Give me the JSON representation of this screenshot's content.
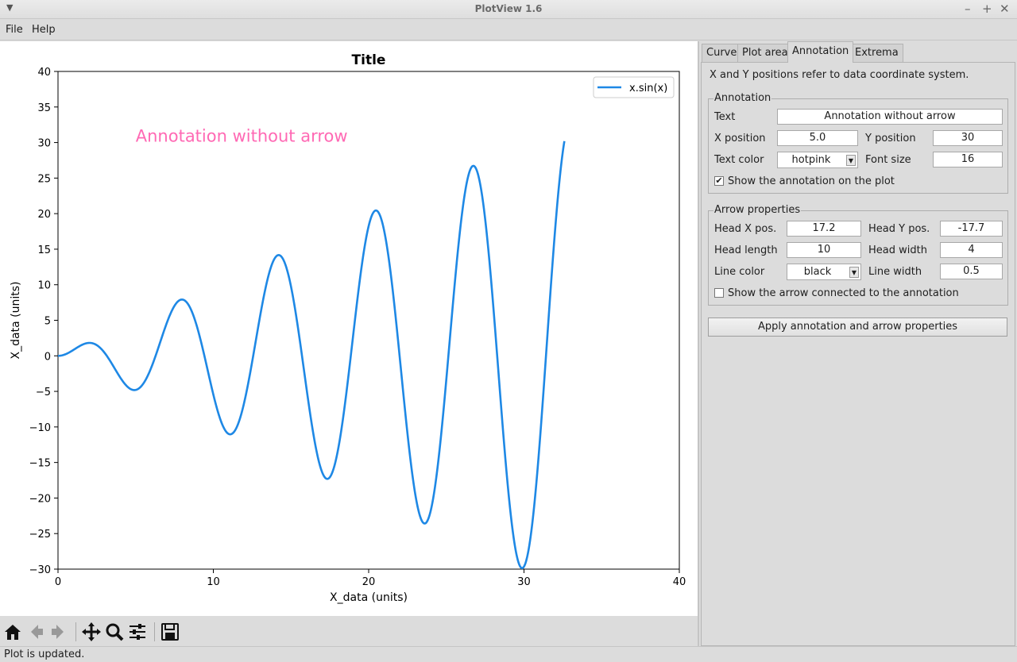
{
  "window": {
    "title": "PlotView 1.6"
  },
  "menu": {
    "file": "File",
    "help": "Help"
  },
  "tabs": [
    "Curve",
    "Plot area",
    "Annotation",
    "Extrema"
  ],
  "active_tab": "Annotation",
  "annotation_panel": {
    "info": "X and Y positions refer to data coordinate system.",
    "group_title": "Annotation",
    "text_label": "Text",
    "text_value": "Annotation without arrow",
    "xpos_label": "X position",
    "xpos_value": "5.0",
    "ypos_label": "Y position",
    "ypos_value": "30",
    "color_label": "Text color",
    "color_value": "hotpink",
    "fontsize_label": "Font size",
    "fontsize_value": "16",
    "show_label": "Show the annotation on the plot",
    "show_checked": true
  },
  "arrow_panel": {
    "group_title": "Arrow properties",
    "headx_label": "Head X pos.",
    "headx_value": "17.2",
    "heady_label": "Head Y pos.",
    "heady_value": "-17.7",
    "headlen_label": "Head length",
    "headlen_value": "10",
    "headwidth_label": "Head width",
    "headwidth_value": "4",
    "linecolor_label": "Line color",
    "linecolor_value": "black",
    "linewidth_label": "Line width",
    "linewidth_value": "0.5",
    "show_label": "Show the arrow connected to the annotation",
    "show_checked": false
  },
  "apply_button": "Apply annotation and arrow properties",
  "status": "Plot is updated.",
  "chart_data": {
    "type": "line",
    "title": "Title",
    "xlabel": "X_data (units)",
    "ylabel": "X_data (units)",
    "xlim": [
      0,
      40
    ],
    "ylim": [
      -30,
      40
    ],
    "xticks": [
      0,
      10,
      20,
      30,
      40
    ],
    "yticks": [
      -30,
      -25,
      -20,
      -15,
      -10,
      -5,
      0,
      5,
      10,
      15,
      20,
      25,
      30,
      35,
      40
    ],
    "grid": false,
    "legend_position": "top-right",
    "series": [
      {
        "name": "x.sin(x)",
        "color": "#1e88e5",
        "function": "x*sin(x)",
        "x_range": [
          0,
          32.6
        ],
        "x": [
          0,
          2.0,
          4.9,
          8.0,
          11.1,
          14.2,
          17.3,
          20.4,
          23.6,
          26.7,
          29.8,
          32.6
        ],
        "y": [
          0,
          1.8,
          -4.8,
          7.9,
          -11.0,
          14.2,
          -17.3,
          20.5,
          -23.6,
          26.7,
          -29.8,
          30.3
        ]
      }
    ],
    "annotations": [
      {
        "text": "Annotation without arrow",
        "x": 5.0,
        "y": 30,
        "color": "hotpink",
        "fontsize": 16
      }
    ]
  }
}
